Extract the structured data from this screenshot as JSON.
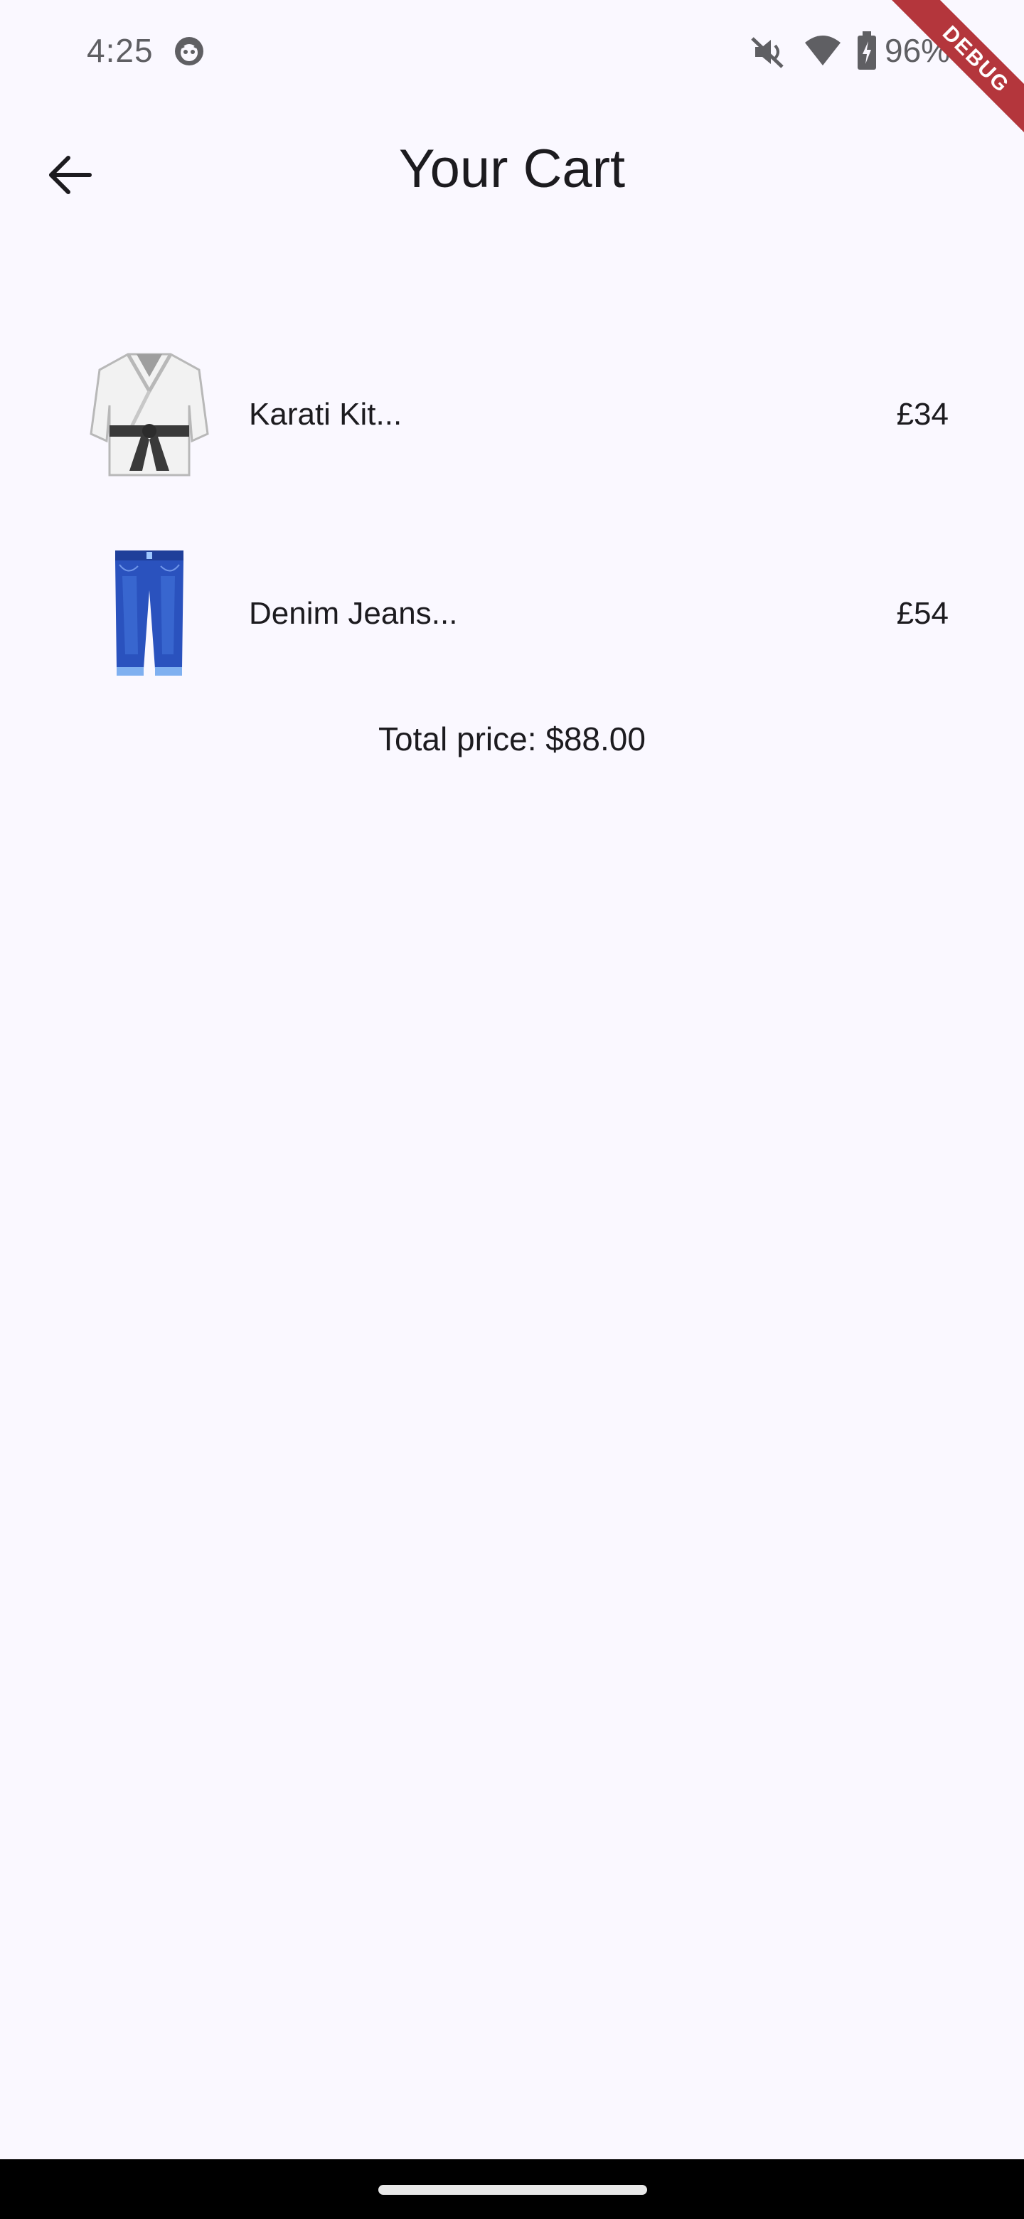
{
  "status_bar": {
    "time": "4:25",
    "battery": "96%",
    "icons": [
      "app-notification-icon",
      "mute-icon",
      "wifi-icon",
      "battery-charging-icon"
    ]
  },
  "debug_banner": "DEBUG",
  "app_bar": {
    "title": "Your Cart",
    "back_icon": "arrow-back-icon"
  },
  "cart": {
    "items": [
      {
        "name": "Karati Kit...",
        "price": "£34",
        "image_icon": "martial-arts-uniform-icon"
      },
      {
        "name": "Denim Jeans...",
        "price": "£54",
        "image_icon": "jeans-icon"
      }
    ],
    "total_label": "Total price: $88.00"
  },
  "colors": {
    "background": "#faf8ff",
    "text": "#1c1b1f",
    "debug_ribbon": "#b4363c",
    "jeans_blue": "#2a52be",
    "belt": "#3a3a3a"
  }
}
